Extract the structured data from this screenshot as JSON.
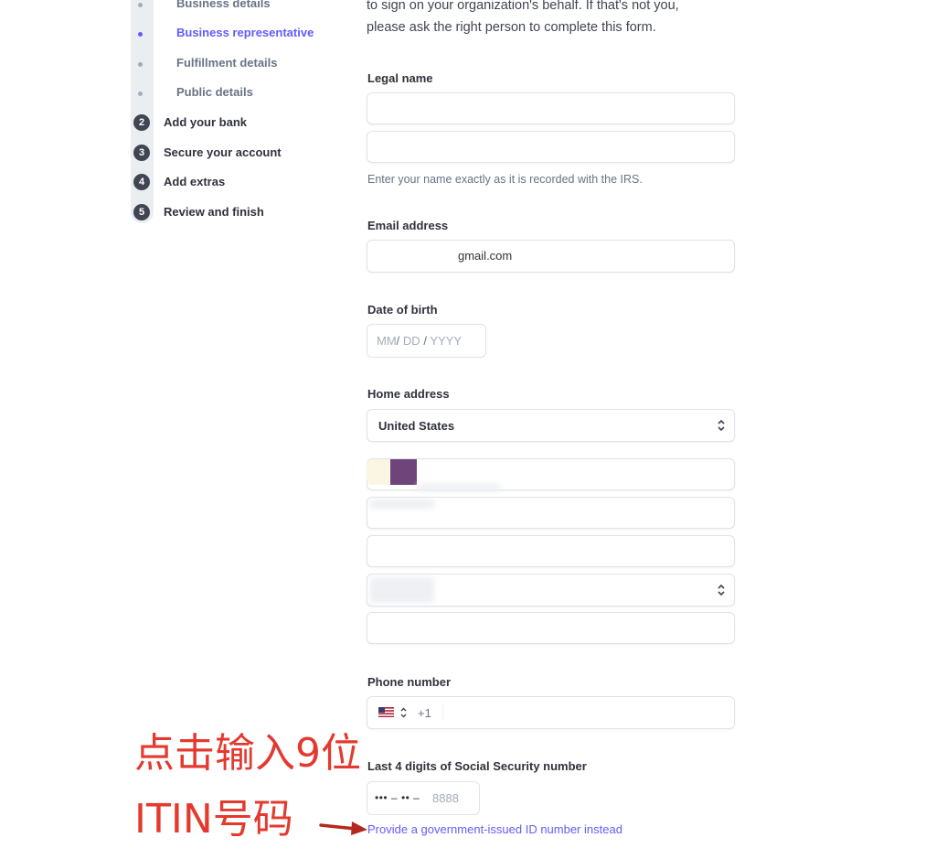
{
  "sidebar": {
    "substeps": [
      {
        "label": "Business details",
        "active": false
      },
      {
        "label": "Business representative",
        "active": true
      },
      {
        "label": "Fulfillment details",
        "active": false
      },
      {
        "label": "Public details",
        "active": false
      }
    ],
    "steps": [
      {
        "number": "2",
        "label": "Add your bank"
      },
      {
        "number": "3",
        "label": "Secure your account"
      },
      {
        "number": "4",
        "label": "Add extras"
      },
      {
        "number": "5",
        "label": "Review and finish"
      }
    ]
  },
  "form": {
    "intro_line1": "to sign on your organization's behalf. If that's not you,",
    "intro_line2": "please ask the right person to complete this form.",
    "legal_name": {
      "label": "Legal name",
      "first_value": "",
      "last_value": "",
      "help": "Enter your name exactly as it is recorded with the IRS."
    },
    "email": {
      "label": "Email address",
      "value_visible": "gmail.com"
    },
    "dob": {
      "label": "Date of birth",
      "mm": "MM",
      "dd": "DD",
      "yyyy": "YYYY",
      "sep": "/"
    },
    "address": {
      "label": "Home address",
      "country": "United States"
    },
    "phone": {
      "label": "Phone number",
      "country_code": "+1"
    },
    "ssn": {
      "label": "Last 4 digits of Social Security number",
      "mask": "••• – •• –",
      "placeholder": "8888",
      "alt_link": "Provide a government-issued ID number instead"
    }
  },
  "annotation": {
    "line1": "点击输入9位",
    "line2": "ITIN号码"
  },
  "colors": {
    "accent": "#635bff",
    "annotation": "#e4392e"
  }
}
